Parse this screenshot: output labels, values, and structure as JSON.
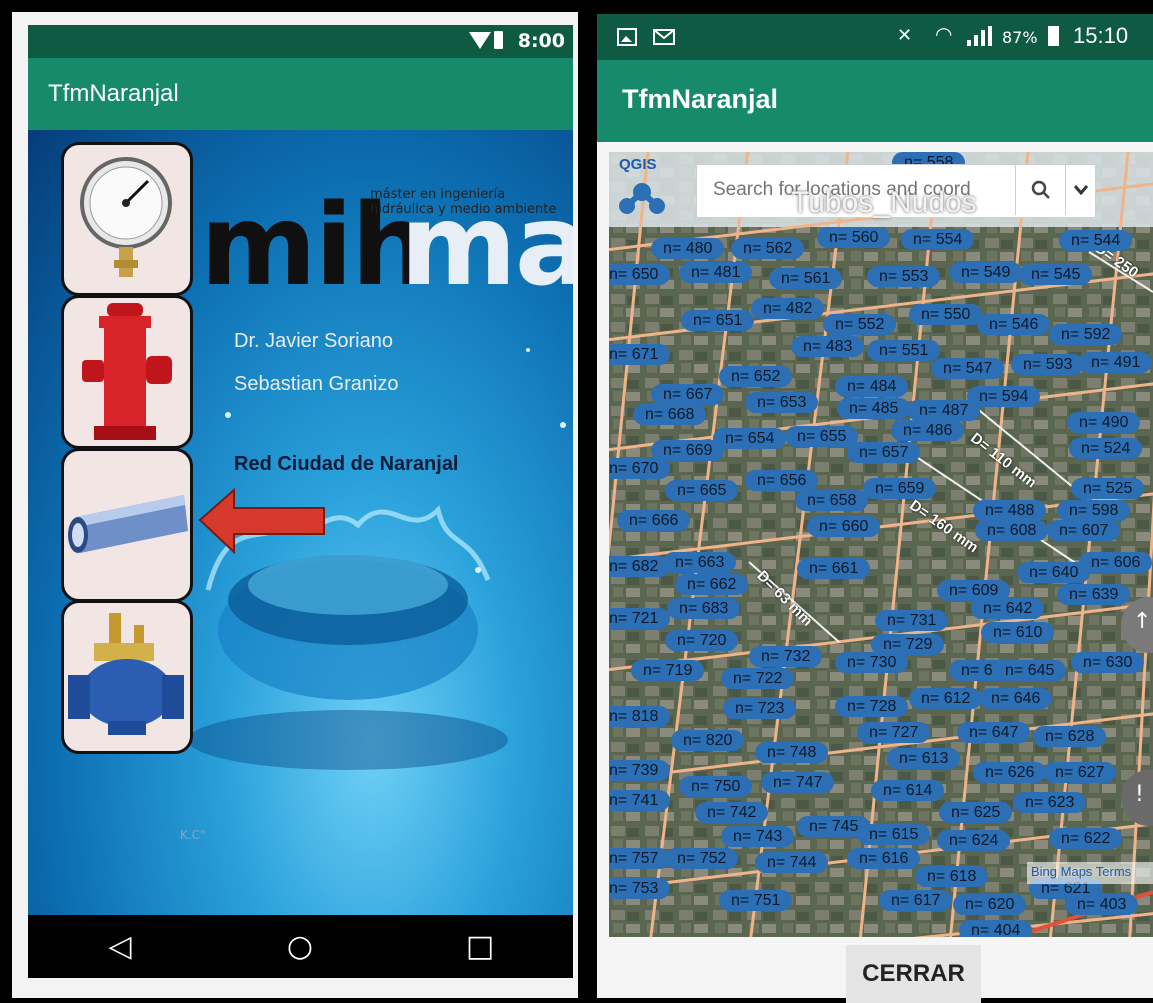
{
  "left_phone": {
    "status_time": "8:00",
    "app_title": "TfmNaranjal",
    "logo_text_dark": "mih",
    "logo_text_light": "ma",
    "logo_tagline_1": "máster en ingeniería",
    "logo_tagline_2": "hidráulica y medio ambiente",
    "author_1": "Dr. Javier Soriano",
    "author_2": "Sebastian Granizo",
    "network_label": "Red Ciudad de Naranjal",
    "watermark": "K.C\"",
    "thumbnails": [
      "pressure-gauge-icon",
      "fire-hydrant-icon",
      "pipe-icon",
      "valve-icon"
    ],
    "nav": {
      "back": "◁",
      "home": "○",
      "recent": "□"
    }
  },
  "right_phone": {
    "status_battery": "87%",
    "status_time": "15:10",
    "app_title": "TfmNaranjal",
    "map": {
      "qgis_logo": "QGIS",
      "search_placeholder": "Search for locations and coord",
      "layer_title": "Tubos_Nudos",
      "attribution": "Bing Maps Terms",
      "diameters": [
        "D= 250",
        "D= 110 mm",
        "D= 160 mm",
        "D= 63 mm"
      ],
      "nodes": [
        "n= 558",
        "n= 480",
        "n= 562",
        "n= 560",
        "n= 554",
        "n= 544",
        "n= 650",
        "n= 481",
        "n= 561",
        "n= 553",
        "n= 549",
        "n= 545",
        "n= 482",
        "n= 651",
        "n= 552",
        "n= 550",
        "n= 546",
        "n= 592",
        "n= 671",
        "n= 483",
        "n= 551",
        "n= 547",
        "n= 593",
        "n= 491",
        "n= 652",
        "n= 667",
        "n= 484",
        "n= 594",
        "n= 668",
        "n= 653",
        "n= 485",
        "n= 487",
        "n= 490",
        "n= 654",
        "n= 655",
        "n= 486",
        "n= 669",
        "n= 657",
        "n= 524",
        "n= 670",
        "n= 656",
        "n= 659",
        "n= 665",
        "n= 525",
        "n= 658",
        "n= 488",
        "n= 598",
        "n= 666",
        "n= 660",
        "n= 608",
        "n= 607",
        "n= 661",
        "n= 663",
        "n= 640",
        "n= 606",
        "n= 682",
        "n= 662",
        "n= 609",
        "n= 639",
        "n= 721",
        "n= 683",
        "n= 642",
        "n= 731",
        "n= 720",
        "n= 610",
        "n= 729",
        "n= 732",
        "n= 719",
        "n= 730",
        "n= 611",
        "n= 645",
        "n= 630",
        "n= 722",
        "n= 612",
        "n= 646",
        "n= 818",
        "n= 723",
        "n= 728",
        "n= 727",
        "n= 647",
        "n= 628",
        "n= 820",
        "n= 748",
        "n= 613",
        "n= 739",
        "n= 626",
        "n= 627",
        "n= 750",
        "n= 747",
        "n= 614",
        "n= 741",
        "n= 742",
        "n= 623",
        "n= 625",
        "n= 745",
        "n= 743",
        "n= 615",
        "n= 624",
        "n= 622",
        "n= 757",
        "n= 752",
        "n= 744",
        "n= 616",
        "n= 618",
        "n= 753",
        "n= 751",
        "n= 617",
        "n= 620",
        "n= 403",
        "n= 404",
        "n= 621"
      ]
    },
    "close_button": "CERRAR"
  }
}
